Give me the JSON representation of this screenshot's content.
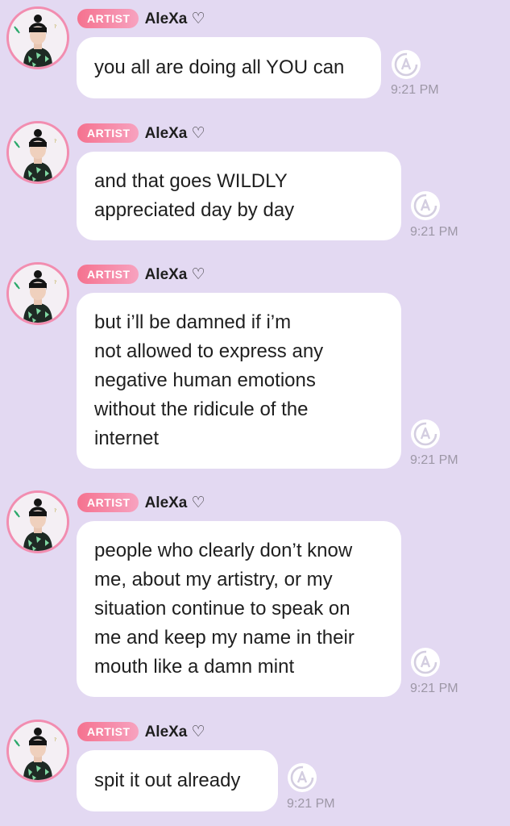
{
  "messages": [
    {
      "badge": "ARTIST",
      "username": "AleXa ♡",
      "text": "you all are doing all YOU can",
      "time": "9:21 PM",
      "react_icon": "reaction-icon"
    },
    {
      "badge": "ARTIST",
      "username": "AleXa ♡",
      "text": "and that goes WILDLY\nappreciated day by day",
      "time": "9:21 PM",
      "react_icon": "reaction-icon"
    },
    {
      "badge": "ARTIST",
      "username": "AleXa ♡",
      "text": "but i’ll be damned if i’m\nnot allowed to express any\nnegative human emotions\nwithout the ridicule of the\ninternet",
      "time": "9:21 PM",
      "react_icon": "reaction-icon"
    },
    {
      "badge": "ARTIST",
      "username": "AleXa ♡",
      "text": "people who clearly don’t know\nme, about my artistry, or my\nsituation continue to speak on\nme and keep my name in their\nmouth like a damn mint",
      "time": "9:21 PM",
      "react_icon": "reaction-icon"
    },
    {
      "badge": "ARTIST",
      "username": "AleXa ♡",
      "text": "spit it out already",
      "time": "9:21 PM",
      "react_icon": "reaction-icon"
    }
  ],
  "colors": {
    "background": "#e3d9f2",
    "badge_start": "#f5728f",
    "badge_end": "#f7a2bf",
    "avatar_ring": "#f28db0",
    "timestamp": "#9d97a6",
    "react_icon": "#d3cde0"
  }
}
